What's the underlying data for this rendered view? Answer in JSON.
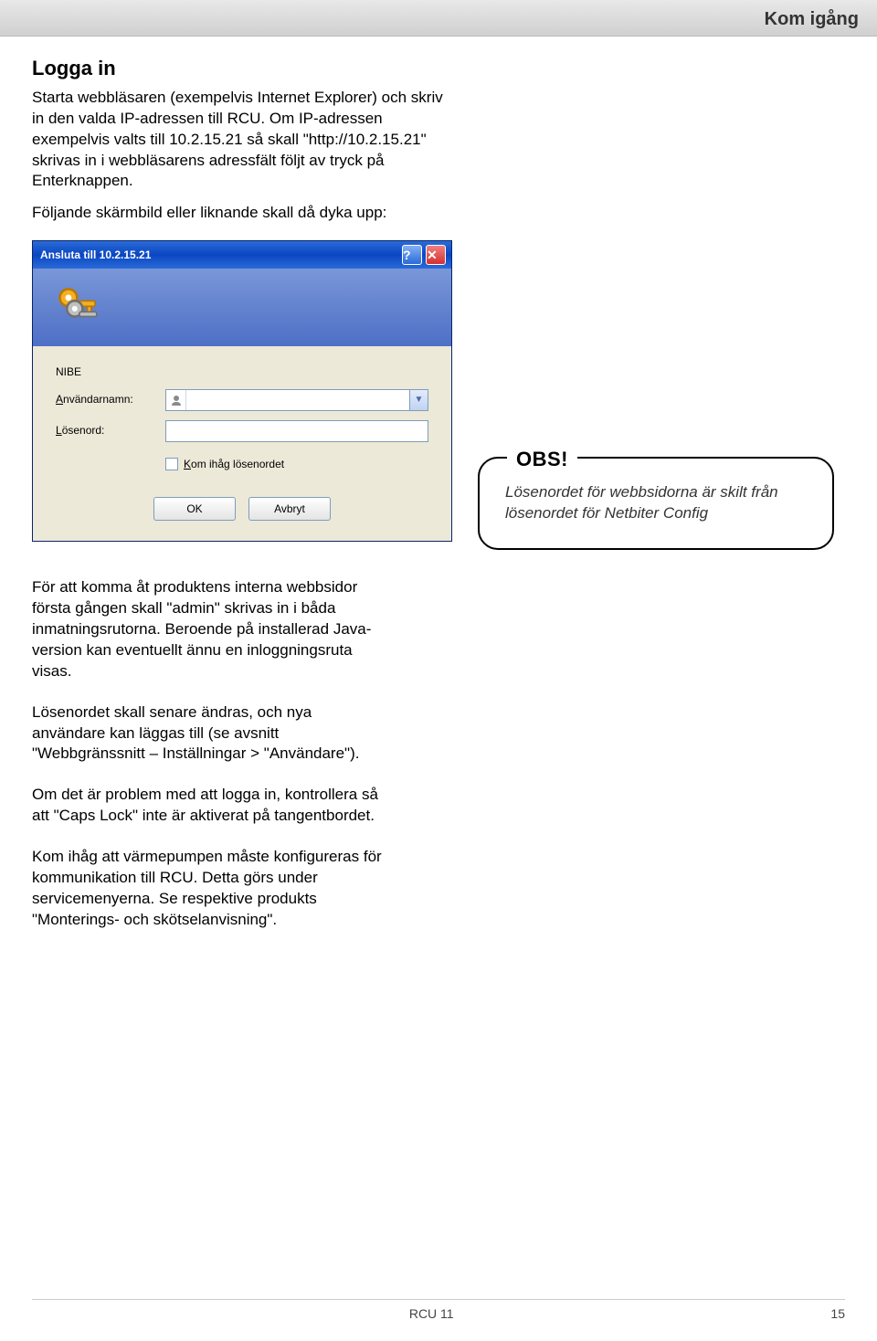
{
  "header": {
    "section_title": "Kom igång"
  },
  "intro": {
    "heading": "Logga in",
    "p1": "Starta webbläsaren (exempelvis Internet Explorer) och skriv in den valda IP-adressen till RCU. Om IP-adressen exempelvis valts till 10.2.15.21 så skall \"http://10.2.15.21\" skrivas in i webbläsarens adressfält följt av tryck på Enterknappen.",
    "p2": "Följande skärmbild eller liknande skall då dyka upp:"
  },
  "dialog": {
    "title": "Ansluta till 10.2.15.21",
    "server_label": "NIBE",
    "user_label": "Användarnamn:",
    "pass_label": "Lösenord:",
    "remember_label": "Kom ihåg lösenordet",
    "ok_label": "OK",
    "cancel_label": "Avbryt",
    "user_value": "",
    "pass_value": ""
  },
  "callout": {
    "title": "OBS!",
    "text": "Lösenordet för webbsidorna är skilt från lösenordet för Netbiter Config"
  },
  "after": {
    "p1": "För att komma åt produktens interna webbsidor första gången skall \"admin\" skrivas in i båda inmatningsrutorna. Beroende på installerad Java-version kan eventuellt ännu en inloggningsruta visas.",
    "p2": "Lösenordet skall senare ändras, och nya användare kan läggas till (se avsnitt \"Webbgränssnitt – Inställningar > \"Användare\").",
    "p3": "Om det är problem med att logga in, kontrollera så att \"Caps Lock\" inte är aktiverat på tangentbordet.",
    "p4": "Kom ihåg att värmepumpen måste konfigureras för kommunikation till RCU. Detta görs under servicemenyerna. Se respektive produkts \"Monterings- och skötselanvisning\"."
  },
  "footer": {
    "doc": "RCU 11",
    "page": "15"
  }
}
